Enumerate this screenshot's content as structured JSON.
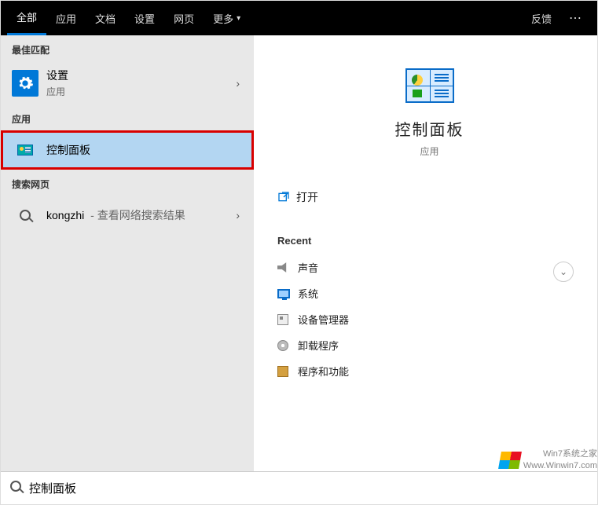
{
  "tabs": {
    "all": "全部",
    "apps": "应用",
    "docs": "文档",
    "settings": "设置",
    "web": "网页",
    "more": "更多"
  },
  "feedback": "反馈",
  "sections": {
    "best_match": "最佳匹配",
    "apps": "应用",
    "web": "搜索网页"
  },
  "results": {
    "settings": {
      "title": "设置",
      "sub": "应用"
    },
    "control_panel": {
      "title": "控制面板"
    },
    "web": {
      "query": "kongzhi",
      "suffix": " - 查看网络搜索结果"
    }
  },
  "preview": {
    "title": "控制面板",
    "sub": "应用",
    "open": "打开",
    "recent_header": "Recent",
    "recent": {
      "sound": "声音",
      "system": "系统",
      "device_manager": "设备管理器",
      "uninstall": "卸载程序",
      "programs_features": "程序和功能"
    }
  },
  "search_value": "控制面板",
  "watermark": {
    "line1": "Win7系统之家",
    "line2": "Www.Winwin7.com"
  }
}
